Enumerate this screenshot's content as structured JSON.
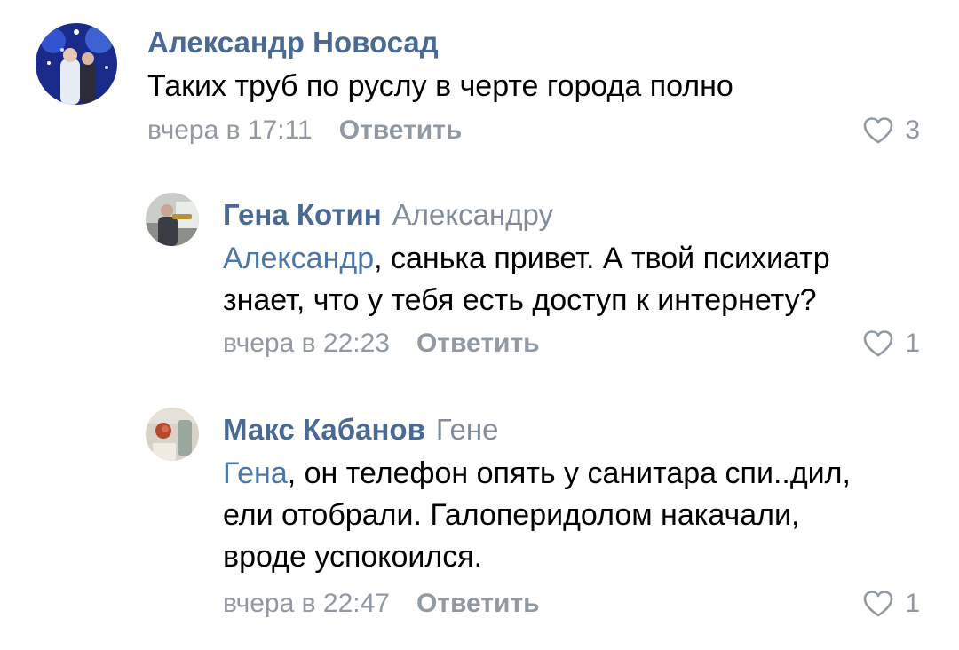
{
  "comments": [
    {
      "author": "Александр Новосад",
      "reply_to": "",
      "text_lines": [
        "Таких труб по руслу в черте города полно"
      ],
      "time": "вчера в 17:11",
      "reply_label": "Ответить",
      "likes": "3"
    },
    {
      "author": "Гена Котин",
      "reply_to": "Александру",
      "mention": "Александр",
      "text_lines": [
        ", санька привет. А твой психиатр",
        "знает, что у тебя есть доступ к интернету?"
      ],
      "time": "вчера в 22:23",
      "reply_label": "Ответить",
      "likes": "1"
    },
    {
      "author": "Макс Кабанов",
      "reply_to": "Гене",
      "mention": "Гена",
      "text_lines": [
        ", он телефон опять у санитара спи..дил,",
        "ели отобрали. Галоперидолом накачали,",
        "вроде успокоился."
      ],
      "time": "вчера в 22:47",
      "reply_label": "Ответить",
      "likes": "1"
    }
  ],
  "colors": {
    "author": "#4a6a93",
    "mention": "#4a77a8",
    "meta": "#9199a3",
    "text": "#000000"
  },
  "icons": [
    "avatar",
    "heart-icon"
  ]
}
